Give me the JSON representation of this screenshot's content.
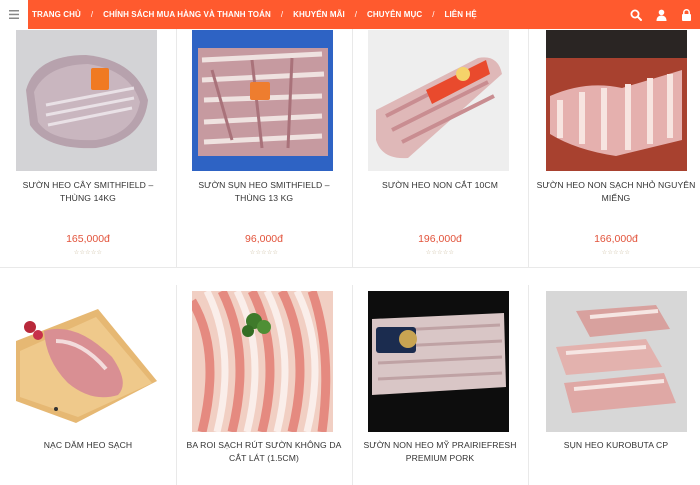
{
  "nav": {
    "items": [
      "TRANG CHỦ",
      "CHÍNH SÁCH MUA HÀNG VÀ THANH TOÁN",
      "KHUYẾN MÃI",
      "CHUYÊN MỤC",
      "LIÊN HỆ"
    ],
    "separator": "/"
  },
  "icons": {
    "menu": "hamburger-icon",
    "search": "search-icon",
    "account": "user-icon",
    "cart": "lock-icon"
  },
  "colors": {
    "brand": "#ff5a2e",
    "price": "#e2533b"
  },
  "products": [
    {
      "name": "SƯỜN HEO CÂY SMITHFIELD – THÙNG 14KG",
      "price": "165,000đ",
      "rating": "☆☆☆☆☆"
    },
    {
      "name": "SƯỜN SỤN HEO SMITHFIELD – THÙNG 13 KG",
      "price": "96,000đ",
      "rating": "☆☆☆☆☆"
    },
    {
      "name": "SƯỜN HEO NON CẮT 10CM",
      "price": "196,000đ",
      "rating": "☆☆☆☆☆"
    },
    {
      "name": "SƯỜN HEO NON SẠCH NHỎ NGUYÊN MIẾNG",
      "price": "166,000đ",
      "rating": "☆☆☆☆☆"
    },
    {
      "name": "NẠC DĂM HEO SẠCH",
      "price": "",
      "rating": ""
    },
    {
      "name": "BA ROI SẠCH RÚT SƯỜN KHÔNG DA CẮT LÁT (1.5CM)",
      "price": "",
      "rating": ""
    },
    {
      "name": "SƯỜN NON HEO MỸ PRAIRIEFRESH PREMIUM PORK",
      "price": "",
      "rating": ""
    },
    {
      "name": "SỤN HEO KUROBUTA CP",
      "price": "",
      "rating": ""
    }
  ]
}
